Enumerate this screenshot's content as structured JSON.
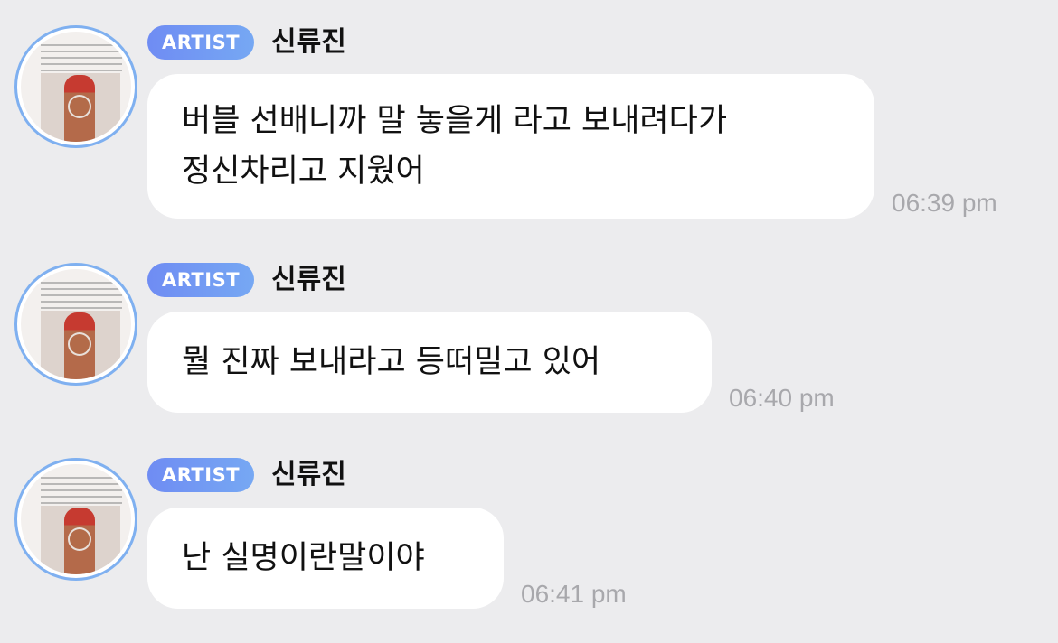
{
  "messages": [
    {
      "badge": "ARTIST",
      "sender": "신류진",
      "text": "버블 선배니까 말 놓을게 라고 보내려다가\n정신차리고 지웠어",
      "time": "06:39 pm"
    },
    {
      "badge": "ARTIST",
      "sender": "신류진",
      "text": "뭘 진짜 보내라고 등떠밀고 있어",
      "time": "06:40 pm"
    },
    {
      "badge": "ARTIST",
      "sender": "신류진",
      "text": "난 실명이란말이야",
      "time": "06:41 pm"
    }
  ],
  "colors": {
    "background": "#ececee",
    "bubble": "#ffffff",
    "badge_start": "#6f8cf3",
    "badge_end": "#76a8f3",
    "avatar_ring": "#7fb0f0",
    "time_text": "#a8a8ac"
  }
}
